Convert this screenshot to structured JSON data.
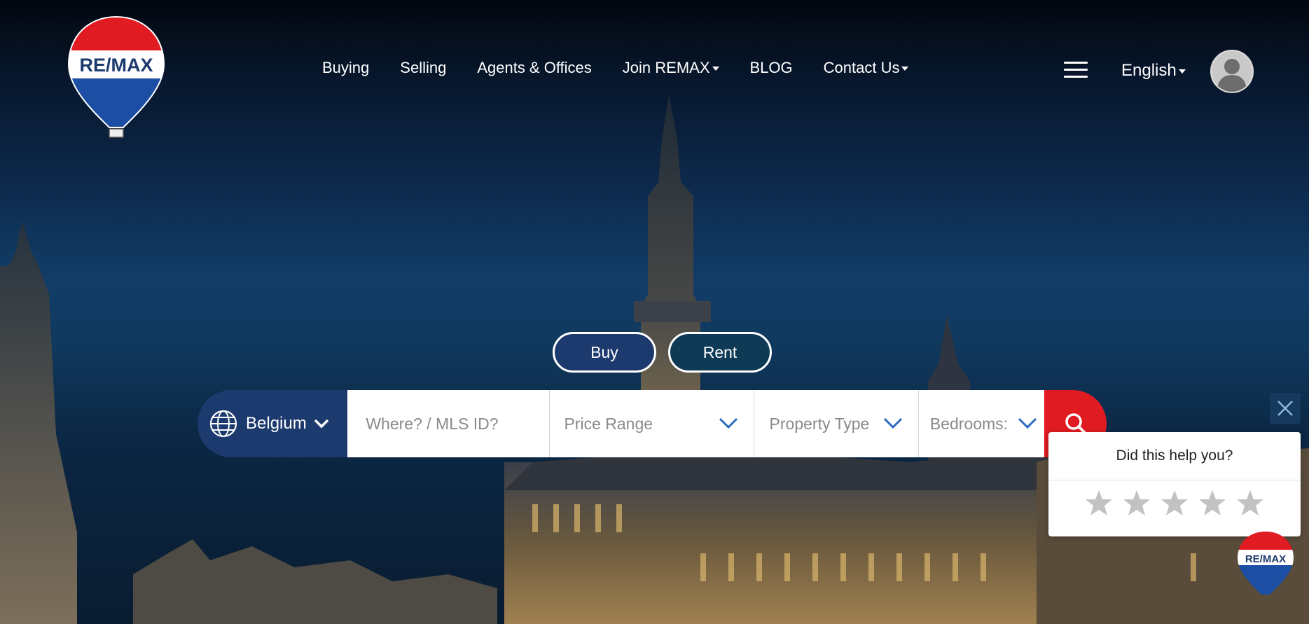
{
  "brand": {
    "logo_text": "RE/MAX",
    "colors": {
      "red": "#e11b22",
      "blue": "#1c3a6e",
      "white": "#ffffff"
    }
  },
  "nav": {
    "items": [
      {
        "label": "Buying",
        "dropdown": false
      },
      {
        "label": "Selling",
        "dropdown": false
      },
      {
        "label": "Agents & Offices",
        "dropdown": false
      },
      {
        "label": "Join REMAX",
        "dropdown": true
      },
      {
        "label": "BLOG",
        "dropdown": false
      },
      {
        "label": "Contact Us",
        "dropdown": true
      }
    ],
    "menu_icon": "hamburger-icon",
    "language": "English",
    "account_icon": "user-avatar-icon"
  },
  "mode": {
    "buy": "Buy",
    "rent": "Rent"
  },
  "search": {
    "country": "Belgium",
    "where_placeholder": "Where? / MLS ID?",
    "price": "Price Range",
    "property_type": "Property Type",
    "bedrooms": "Bedrooms:",
    "search_icon": "search-icon"
  },
  "feedback": {
    "question": "Did this help you?",
    "stars": 5,
    "close_icon": "close-icon"
  }
}
